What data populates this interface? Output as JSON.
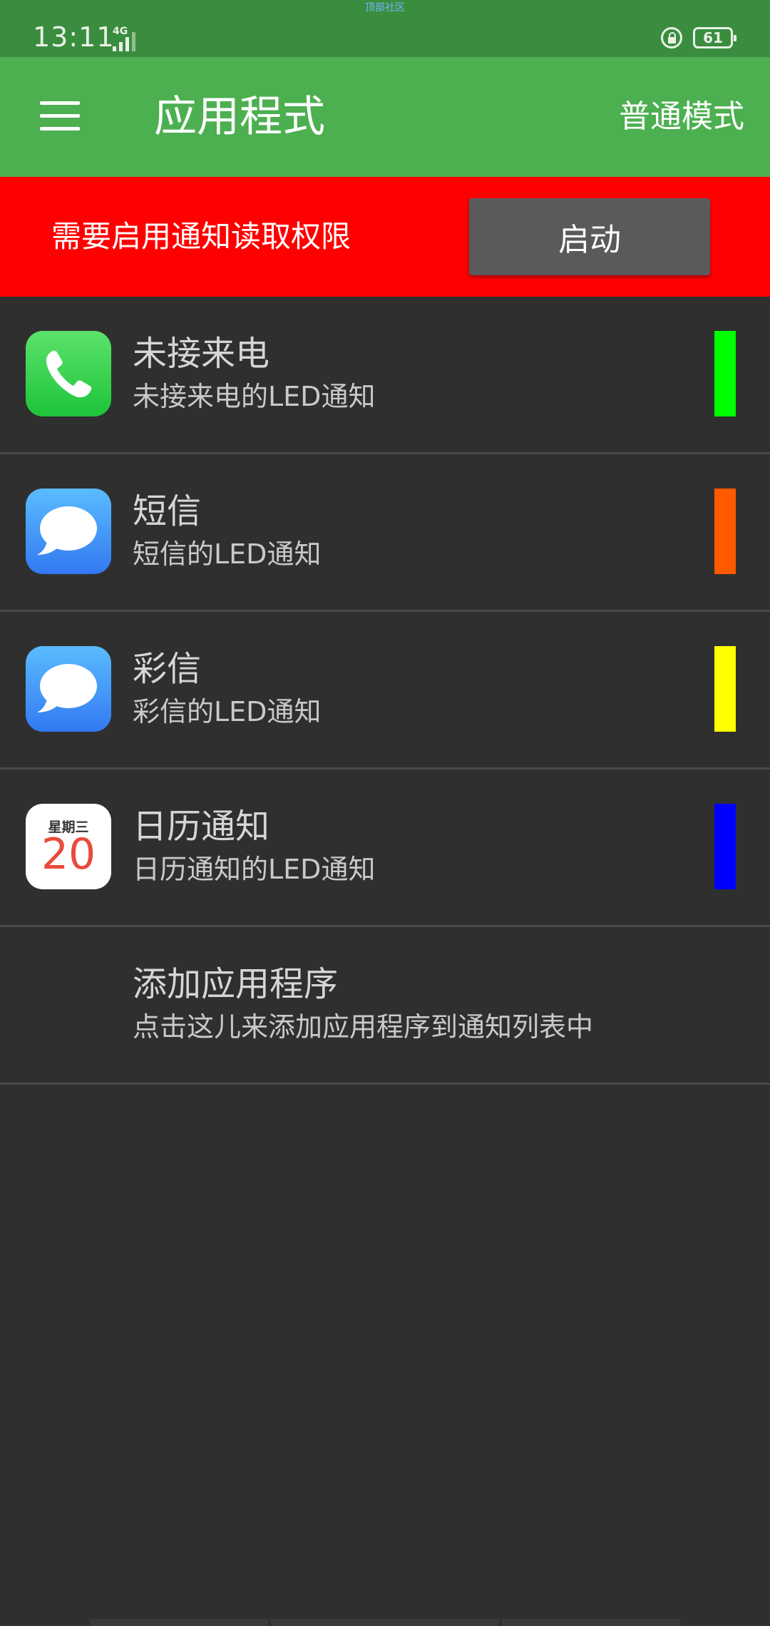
{
  "status_bar": {
    "time": "13:11",
    "network": "4G",
    "top_label": "顶部社区",
    "battery": "61"
  },
  "app_bar": {
    "title": "应用程式",
    "mode": "普通模式"
  },
  "banner": {
    "message": "需要启用通知读取权限",
    "button_label": "启动",
    "color": "#ff0000"
  },
  "items": [
    {
      "title": "未接来电",
      "subtitle": "未接来电的LED通知",
      "icon": "phone-icon",
      "color": "#00ff00"
    },
    {
      "title": "短信",
      "subtitle": "短信的LED通知",
      "icon": "message-icon",
      "color": "#ff5a00"
    },
    {
      "title": "彩信",
      "subtitle": "彩信的LED通知",
      "icon": "message-icon",
      "color": "#ffff00"
    },
    {
      "title": "日历通知",
      "subtitle": "日历通知的LED通知",
      "icon": "calendar-icon",
      "color": "#0000ff"
    }
  ],
  "calendar_icon": {
    "weekday": "星期三",
    "day": "20"
  },
  "add_item": {
    "title": "添加应用程序",
    "subtitle": "点击这儿来添加应用程序到通知列表中"
  },
  "colors": {
    "status_bar": "#3a8d3e",
    "app_bar": "#4caf50",
    "background": "#2f2f2f"
  }
}
